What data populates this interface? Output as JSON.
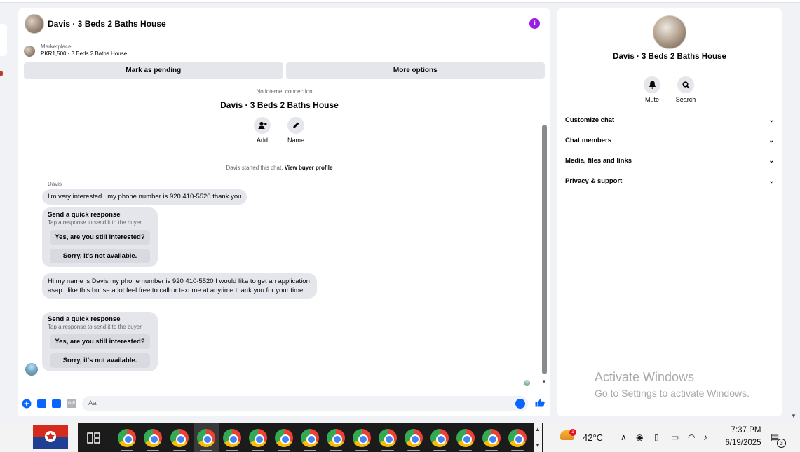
{
  "conversation": {
    "header_title": "Davis · 3 Beds 2 Baths House",
    "listing_category": "Marketplace",
    "listing_price": "PKR1,500 - 3 Beds 2 Baths House",
    "buttons": {
      "mark_pending": "Mark as pending",
      "more_options": "More options"
    },
    "status": "No internet connection",
    "title": "Davis · 3 Beds 2 Baths House",
    "actions": {
      "add": "Add",
      "name": "Name"
    },
    "started_text": "Davis started this chat.",
    "view_profile": "View buyer profile",
    "sender_name": "Davis",
    "messages": [
      {
        "text": "I'm very interested.. my phone number is 920 410-5520 thank you"
      },
      {
        "text": "Hi my name is Davis my phone number is 920 410-5520 I would like to get an application asap I like this house a lot feel free to call or text me at anytime thank you for your time"
      }
    ],
    "quick_responses": [
      {
        "title": "Send a quick response",
        "subtitle": "Tap a response to send it to the buyer.",
        "option1": "Yes, are you still interested?",
        "option2": "Sorry, it's not available."
      },
      {
        "title": "Send a quick response",
        "subtitle": "Tap a response to send it to the buyer.",
        "option1": "Yes, are you still interested?",
        "option2": "Sorry, it's not available."
      }
    ],
    "composer_placeholder": "Aa",
    "gif_label": "GIF"
  },
  "info_panel": {
    "title": "Davis · 3 Beds 2 Baths House",
    "mute": "Mute",
    "search": "Search",
    "menu": [
      "Customize chat",
      "Chat members",
      "Media, files and links",
      "Privacy & support"
    ]
  },
  "watermark": {
    "line1": "Activate Windows",
    "line2": "Go to Settings to activate Windows."
  },
  "taskbar": {
    "weather_badge": "1",
    "temperature": "42°C",
    "time": "7:37 PM",
    "date": "6/19/2025",
    "notification_count": "3"
  },
  "colors": {
    "accent": "#0866ff",
    "info_icon": "#9b1ee8"
  }
}
